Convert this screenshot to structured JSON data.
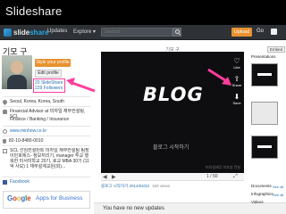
{
  "slide_title": "Slideshare",
  "topbar": {
    "logo_slide": "slide",
    "logo_share": "share",
    "nav_updates": "Updates",
    "nav_explore": "Explore ▾",
    "search_placeholder": "Search",
    "upload": "Upload",
    "go": "Go"
  },
  "profile": {
    "name": "기모 구",
    "style_button": "Style your profile",
    "edit_button": "Edit profile",
    "slides_count": "20 SlideShare",
    "followers_count": "229 Followers",
    "location": "Seoul, Korea, Korea, South",
    "job": "Financial Advisor at 미자일 재무컨설팅, SCL",
    "industry": "Finance / Banking / Insurance",
    "website": "www.minhow.co.kr",
    "phone": "82-10-8480-0010",
    "about": "SCL 선임컨설턴트 미자일 재무컨설팅 팀장 이민호에스- 정보처리기, manager 투교 행복한 미서미학교 20기, 로교 MBA 30기 (11억 사모) 1 재무설계교원(회)...",
    "facebook": "Facebook",
    "ad_google": [
      "G",
      "o",
      "o",
      "g",
      "l",
      "e"
    ],
    "ad_rest": "Apps for Business"
  },
  "viewer": {
    "title": "기모 구",
    "slide_main": "BLOG",
    "slide_caption": "블로그 시작하기",
    "slide_footer": "미자일재무 미자일 컨설",
    "actions": {
      "like": "Like",
      "share": "Share",
      "save": "Save"
    },
    "page_indicator": "1 / 50",
    "meta_date": "블로그 시작하기 2014/04/22",
    "meta_views": "160 views",
    "updates": "You have no new updates"
  },
  "sidebar": {
    "embed": "Embed",
    "presentations": "Presentations",
    "see_all_1": "See all",
    "documents": "Documents",
    "see_all_2": "See all",
    "infographics": "Infographics",
    "videos": "Videos"
  }
}
